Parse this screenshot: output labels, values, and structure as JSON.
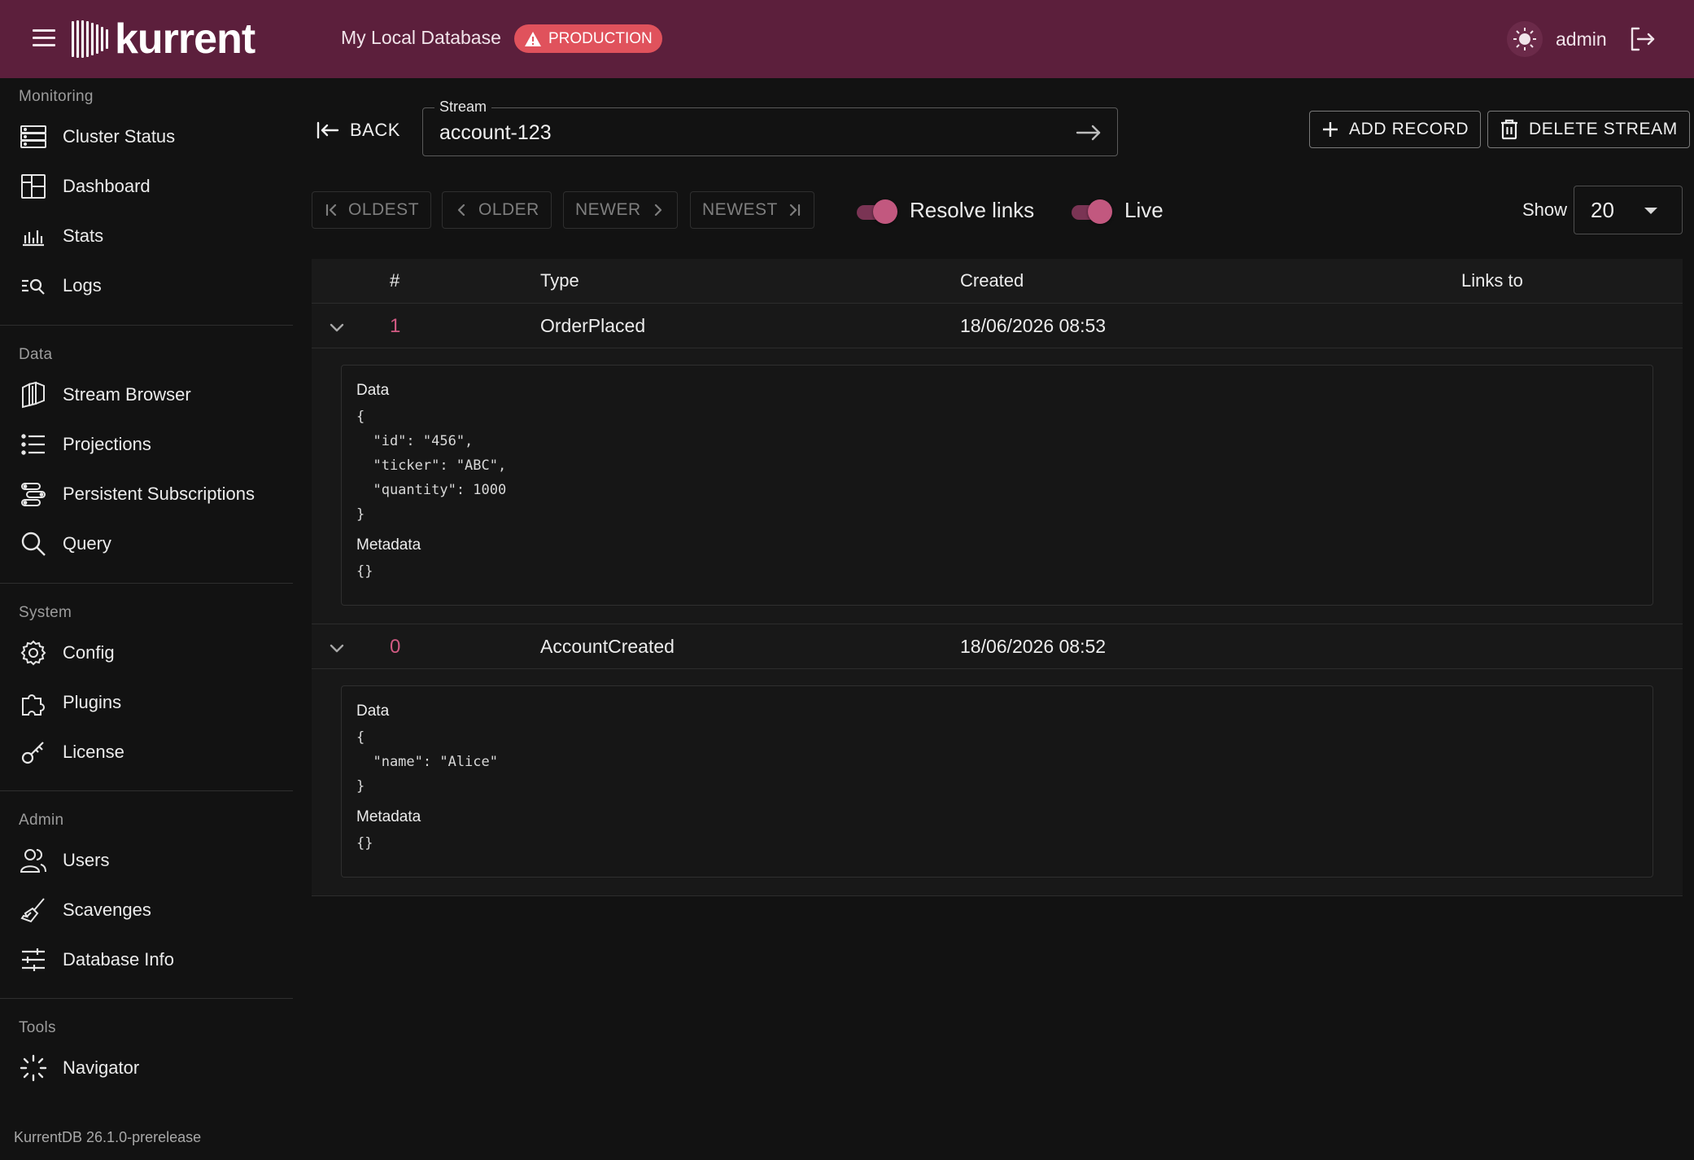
{
  "header": {
    "logo_text": "kurrent",
    "db_name": "My Local Database",
    "env_badge": "PRODUCTION",
    "user": "admin"
  },
  "colors": {
    "topbar": "#5c1f3c",
    "badge": "#e0525c",
    "accent": "#c2587f",
    "event_number": "#d05a82"
  },
  "sidebar": {
    "sections": [
      {
        "heading": "Monitoring",
        "items": [
          {
            "label": "Cluster Status",
            "icon": "server-icon"
          },
          {
            "label": "Dashboard",
            "icon": "dashboard-icon"
          },
          {
            "label": "Stats",
            "icon": "bar-chart-icon"
          },
          {
            "label": "Logs",
            "icon": "log-search-icon"
          }
        ]
      },
      {
        "heading": "Data",
        "items": [
          {
            "label": "Stream Browser",
            "icon": "stream-icon"
          },
          {
            "label": "Projections",
            "icon": "list-icon"
          },
          {
            "label": "Persistent Subscriptions",
            "icon": "subscriptions-icon"
          },
          {
            "label": "Query",
            "icon": "search-icon"
          }
        ]
      },
      {
        "heading": "System",
        "items": [
          {
            "label": "Config",
            "icon": "gear-icon"
          },
          {
            "label": "Plugins",
            "icon": "puzzle-icon"
          },
          {
            "label": "License",
            "icon": "key-icon"
          }
        ]
      },
      {
        "heading": "Admin",
        "items": [
          {
            "label": "Users",
            "icon": "users-icon"
          },
          {
            "label": "Scavenges",
            "icon": "broom-icon"
          },
          {
            "label": "Database Info",
            "icon": "sliders-icon"
          }
        ]
      },
      {
        "heading": "Tools",
        "items": [
          {
            "label": "Navigator",
            "icon": "loader-icon"
          }
        ]
      }
    ],
    "version": "KurrentDB 26.1.0-prerelease"
  },
  "toolbar": {
    "back_label": "BACK",
    "stream_legend": "Stream",
    "stream_value": "account-123",
    "add_record_label": "ADD RECORD",
    "delete_stream_label": "DELETE STREAM"
  },
  "pager": {
    "oldest": "OLDEST",
    "older": "OLDER",
    "newer": "NEWER",
    "newest": "NEWEST",
    "resolve_links_label": "Resolve links",
    "resolve_links_on": true,
    "live_label": "Live",
    "live_on": true,
    "show_label": "Show",
    "show_value": "20"
  },
  "table": {
    "columns": [
      "#",
      "Type",
      "Created",
      "Links to"
    ],
    "rows": [
      {
        "number": "1",
        "type": "OrderPlaced",
        "created": "18/06/2026 08:53",
        "links_to": "",
        "data_label": "Data",
        "data": "{\n  \"id\": \"456\",\n  \"ticker\": \"ABC\",\n  \"quantity\": 1000\n}",
        "metadata_label": "Metadata",
        "metadata": "{}"
      },
      {
        "number": "0",
        "type": "AccountCreated",
        "created": "18/06/2026 08:52",
        "links_to": "",
        "data_label": "Data",
        "data": "{\n  \"name\": \"Alice\"\n}",
        "metadata_label": "Metadata",
        "metadata": "{}"
      }
    ]
  }
}
